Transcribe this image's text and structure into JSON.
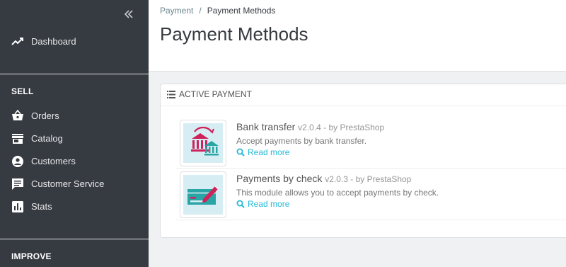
{
  "sidebar": {
    "dashboard": "Dashboard",
    "sections": {
      "sell": "SELL",
      "improve": "IMPROVE"
    },
    "items": [
      {
        "label": "Orders",
        "icon": "basket-icon"
      },
      {
        "label": "Catalog",
        "icon": "store-icon"
      },
      {
        "label": "Customers",
        "icon": "account-circle-icon"
      },
      {
        "label": "Customer Service",
        "icon": "chat-icon"
      },
      {
        "label": "Stats",
        "icon": "bar-chart-icon"
      }
    ]
  },
  "header": {
    "breadcrumb_parent": "Payment",
    "breadcrumb_separator": "/",
    "breadcrumb_current": "Payment Methods",
    "title": "Payment Methods"
  },
  "panel": {
    "title": "Active payment",
    "modules": [
      {
        "name": "Bank transfer",
        "version": "v2.0.4 - by PrestaShop",
        "description": "Accept payments by bank transfer.",
        "read_more": "Read more"
      },
      {
        "name": "Payments by check",
        "version": "v2.0.3 - by PrestaShop",
        "description": "This module allows you to accept payments by check.",
        "read_more": "Read more"
      }
    ]
  },
  "colors": {
    "sidebar_bg": "#363a41",
    "accent": "#25b9d7",
    "module_pink": "#d0215a",
    "module_teal": "#2aa5a5"
  }
}
